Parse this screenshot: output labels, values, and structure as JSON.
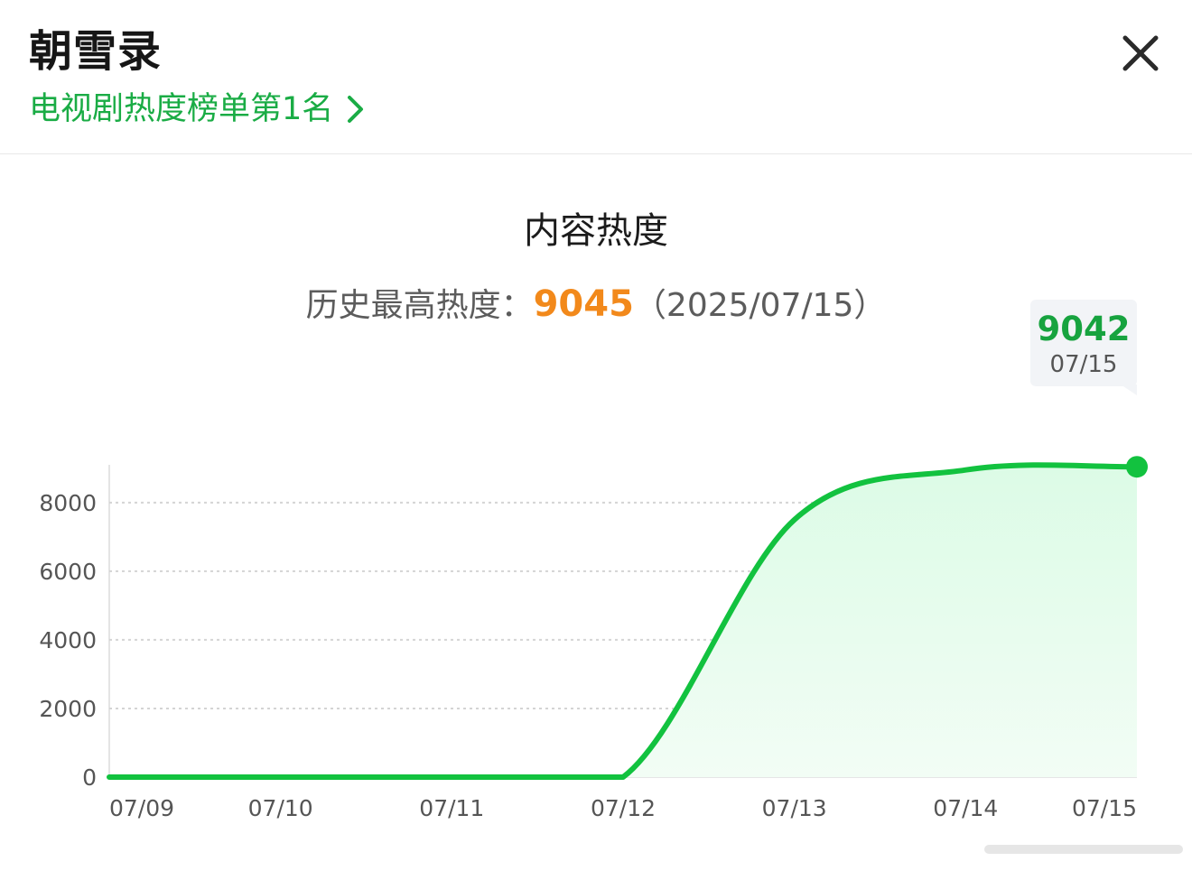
{
  "header": {
    "title": "朝雪录",
    "rank_text": "电视剧热度榜单第1名"
  },
  "icons": {
    "rank_chevron": "chevron-right-icon",
    "close": "close-icon"
  },
  "chart_header": {
    "title": "内容热度",
    "peak_prefix": "历史最高热度：",
    "peak_value": "9045",
    "peak_date": "（2025/07/15）"
  },
  "tooltip": {
    "value": "9042",
    "date": "07/15"
  },
  "colors": {
    "accent": "#1aac45",
    "line": "#12c23f",
    "peak": "#f2891b",
    "fill": "#dcfbe6"
  },
  "chart_data": {
    "type": "area",
    "x": [
      "07/09",
      "07/10",
      "07/11",
      "07/12",
      "07/13",
      "07/14",
      "07/15"
    ],
    "values": [
      0,
      0,
      0,
      0,
      7500,
      8950,
      9042
    ],
    "ylim": [
      0,
      9100
    ],
    "yticks": [
      0,
      2000,
      4000,
      6000,
      8000
    ],
    "grid": true,
    "highlight_index": 6
  }
}
